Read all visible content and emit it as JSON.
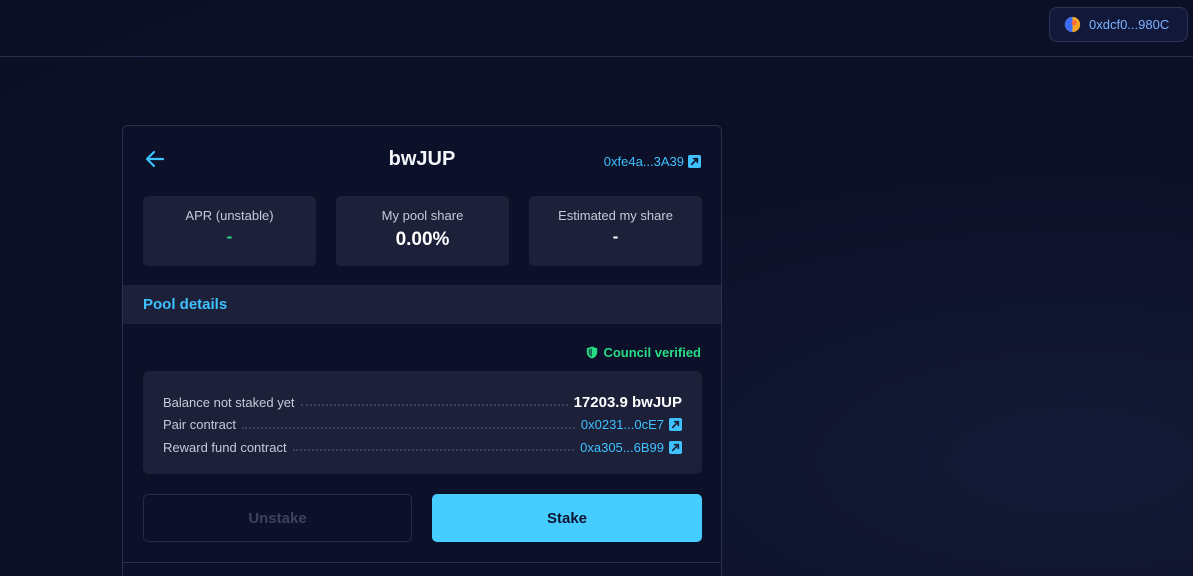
{
  "header": {
    "wallet_address": "0xdcf0...980C",
    "wallet_icon": "wallet-avatar-icon"
  },
  "pool": {
    "title": "bwJUP",
    "contract_address": "0xfe4a...3A39"
  },
  "stats": [
    {
      "label": "APR (unstable)",
      "value": "-",
      "value_color": "#28dc86"
    },
    {
      "label": "My pool share",
      "value": "0.00%",
      "value_color": "#ffffff"
    },
    {
      "label": "Estimated my share",
      "value": "-",
      "value_color": "#ffffff"
    }
  ],
  "section": {
    "title": "Pool details",
    "verified_label": "Council verified"
  },
  "details": {
    "balance_label": "Balance not staked yet",
    "balance_value": "17203.9 bwJUP",
    "pair_label": "Pair contract",
    "pair_value": "0x0231...0cE7",
    "reward_label": "Reward fund contract",
    "reward_value": "0xa305...6B99"
  },
  "actions": {
    "unstake_label": "Unstake",
    "stake_label": "Stake"
  },
  "colors": {
    "accent": "#3fc1ff",
    "verified": "#28dc86",
    "stake_button": "#46cdff"
  }
}
